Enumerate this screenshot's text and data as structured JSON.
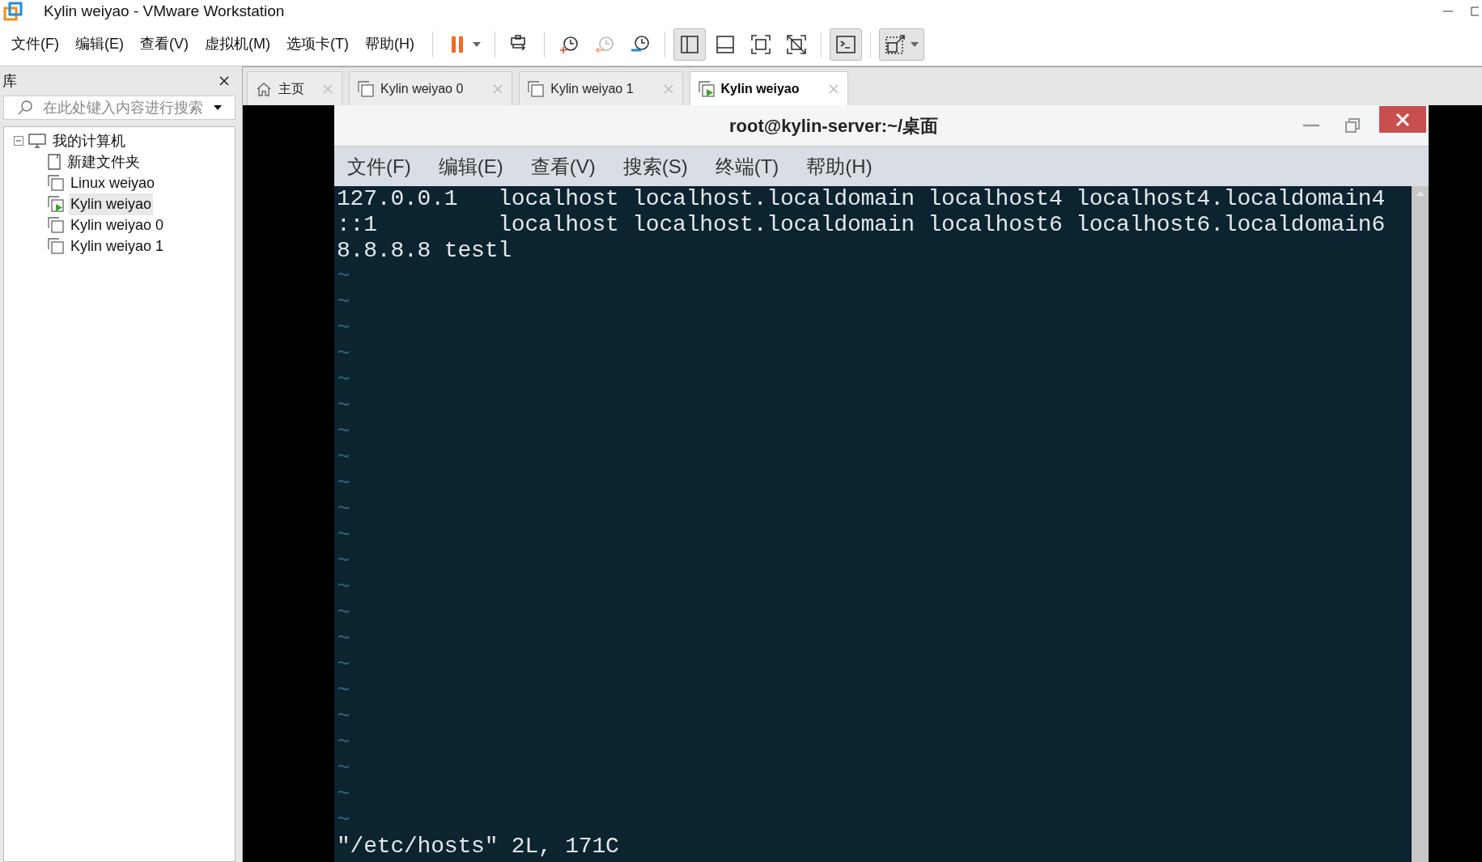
{
  "app_window": {
    "title": "Kylin weiyao - VMware Workstation"
  },
  "menu": [
    "文件(F)",
    "编辑(E)",
    "查看(V)",
    "虚拟机(M)",
    "选项卡(T)",
    "帮助(H)"
  ],
  "toolbar_groups": [
    {
      "buttons": [
        {
          "kind": "pause",
          "pressed": false,
          "menu": true
        }
      ]
    },
    {
      "buttons": [
        {
          "kind": "send-keys",
          "pressed": false,
          "menu": false
        }
      ]
    },
    {
      "buttons": [
        {
          "kind": "snapshot-take",
          "pressed": false,
          "menu": false
        },
        {
          "kind": "snapshot-revert",
          "pressed": false,
          "menu": false
        },
        {
          "kind": "snapshot-manage",
          "pressed": false,
          "menu": false
        }
      ]
    },
    {
      "buttons": [
        {
          "kind": "view-library",
          "pressed": true,
          "menu": false
        },
        {
          "kind": "view-thumbs",
          "pressed": false,
          "menu": false
        },
        {
          "kind": "fullscreen",
          "pressed": false,
          "menu": false
        },
        {
          "kind": "unity",
          "pressed": false,
          "menu": false
        }
      ]
    },
    {
      "buttons": [
        {
          "kind": "console",
          "pressed": true,
          "menu": false
        }
      ]
    },
    {
      "buttons": [
        {
          "kind": "stretch",
          "pressed": true,
          "menu": true
        }
      ]
    }
  ],
  "library": {
    "title": "库",
    "search": {
      "placeholder": "在此处键入内容进行搜索"
    },
    "tree": [
      {
        "label": "我的计算机",
        "kind": "computer",
        "selected": false,
        "expanded": true,
        "children": [
          {
            "label": "新建文件夹",
            "kind": "folder",
            "selected": false
          },
          {
            "label": "Linux weiyao",
            "kind": "vm",
            "selected": false
          },
          {
            "label": "Kylin weiyao",
            "kind": "vm-running",
            "selected": true
          },
          {
            "label": "Kylin weiyao 0",
            "kind": "vm",
            "selected": false
          },
          {
            "label": "Kylin weiyao 1",
            "kind": "vm",
            "selected": false
          }
        ]
      }
    ]
  },
  "tabs": [
    {
      "label": "主页",
      "kind": "home",
      "selected": false
    },
    {
      "label": "Kylin weiyao 0",
      "kind": "vm",
      "selected": false
    },
    {
      "label": "Kylin weiyao 1",
      "kind": "vm",
      "selected": false
    },
    {
      "label": "Kylin weiyao",
      "kind": "vm-running",
      "selected": true
    }
  ],
  "terminal": {
    "title": "root@kylin-server:~/桌面",
    "menu": [
      "文件(F)",
      "编辑(E)",
      "查看(V)",
      "搜索(S)",
      "终端(T)",
      "帮助(H)"
    ],
    "lines": [
      {
        "kind": "text",
        "text": "127.0.0.1   localhost localhost.localdomain localhost4 localhost4.localdomain4"
      },
      {
        "kind": "text",
        "text": "::1         localhost localhost.localdomain localhost6 localhost6.localdomain6"
      },
      {
        "kind": "text",
        "text": "8.8.8.8 testl"
      },
      {
        "kind": "filler",
        "text": "~"
      },
      {
        "kind": "filler",
        "text": "~"
      },
      {
        "kind": "filler",
        "text": "~"
      },
      {
        "kind": "filler",
        "text": "~"
      },
      {
        "kind": "filler",
        "text": "~"
      },
      {
        "kind": "filler",
        "text": "~"
      },
      {
        "kind": "filler",
        "text": "~"
      },
      {
        "kind": "filler",
        "text": "~"
      },
      {
        "kind": "filler",
        "text": "~"
      },
      {
        "kind": "filler",
        "text": "~"
      },
      {
        "kind": "filler",
        "text": "~"
      },
      {
        "kind": "filler",
        "text": "~"
      },
      {
        "kind": "filler",
        "text": "~"
      },
      {
        "kind": "filler",
        "text": "~"
      },
      {
        "kind": "filler",
        "text": "~"
      },
      {
        "kind": "filler",
        "text": "~"
      },
      {
        "kind": "filler",
        "text": "~"
      },
      {
        "kind": "filler",
        "text": "~"
      },
      {
        "kind": "filler",
        "text": "~"
      },
      {
        "kind": "filler",
        "text": "~"
      },
      {
        "kind": "filler",
        "text": "~"
      },
      {
        "kind": "filler",
        "text": "~"
      }
    ],
    "status": "\"/etc/hosts\" 2L, 171C"
  }
}
